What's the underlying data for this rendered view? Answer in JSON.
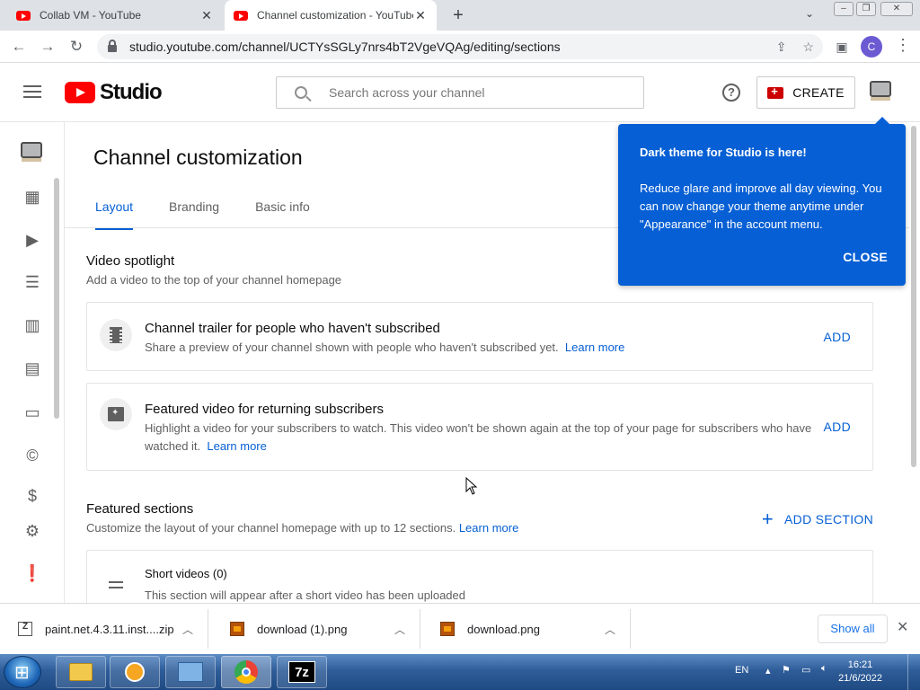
{
  "browser": {
    "tabs": [
      {
        "title": "Collab VM - YouTube"
      },
      {
        "title": "Channel customization - YouTube"
      }
    ],
    "url": "studio.youtube.com/channel/UCTYsSGLy7nrs4bT2VgeVQAg/editing/sections",
    "profile_initial": "C"
  },
  "header": {
    "logo_text": "Studio",
    "search_placeholder": "Search across your channel",
    "create_label": "CREATE"
  },
  "page": {
    "title": "Channel customization",
    "tabs": [
      "Layout",
      "Branding",
      "Basic info"
    ],
    "active_tab": "Layout"
  },
  "spotlight": {
    "title": "Video spotlight",
    "subtitle": "Add a video to the top of your channel homepage",
    "cards": [
      {
        "title": "Channel trailer for people who haven't subscribed",
        "desc": "Share a preview of your channel shown with people who haven't subscribed yet.",
        "link": "Learn more",
        "action": "ADD"
      },
      {
        "title": "Featured video for returning subscribers",
        "desc": "Highlight a video for your subscribers to watch. This video won't be shown again at the top of your page for subscribers who have watched it.",
        "link": "Learn more",
        "action": "ADD"
      }
    ]
  },
  "featured": {
    "title": "Featured sections",
    "subtitle": "Customize the layout of your channel homepage with up to 12 sections.",
    "link": "Learn more",
    "add_section_label": "ADD SECTION",
    "sections": [
      {
        "title": "Short videos (0)",
        "desc": "This section will appear after a short video has been uploaded"
      }
    ]
  },
  "tooltip": {
    "heading": "Dark theme for Studio is here!",
    "body": "Reduce glare and improve all day viewing. You can now change your theme anytime under \"Appearance\" in the account menu.",
    "close_label": "CLOSE"
  },
  "downloads": {
    "items": [
      {
        "name": "paint.net.4.3.11.inst....zip",
        "type": "zip"
      },
      {
        "name": "download (1).png",
        "type": "png"
      },
      {
        "name": "download.png",
        "type": "png"
      }
    ],
    "show_all_label": "Show all"
  },
  "taskbar": {
    "language": "EN",
    "time": "16:21",
    "date": "21/6/2022"
  },
  "colors": {
    "accent": "#065fd4",
    "brand_red": "#ff0000",
    "tooltip_bg": "#065fd4"
  }
}
